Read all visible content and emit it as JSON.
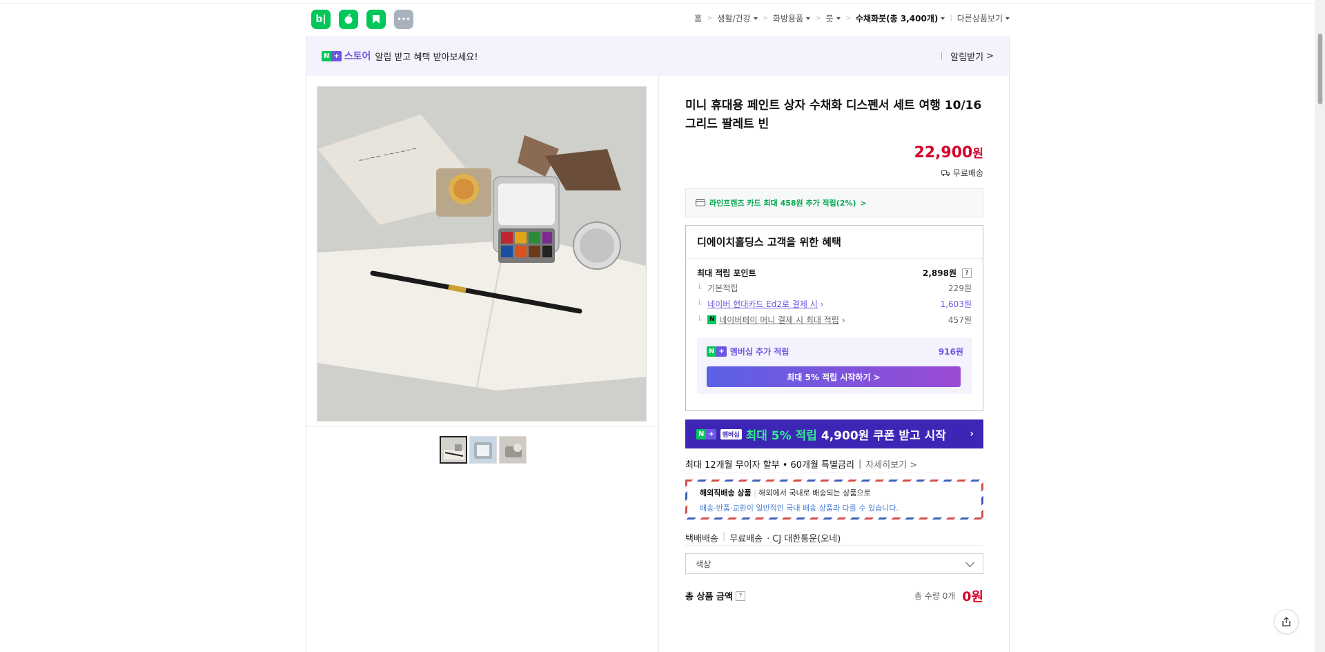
{
  "top_apps": [
    {
      "name": "blog-app-icon",
      "label": "b|",
      "color": "#03c75a"
    },
    {
      "name": "cafe-app-icon",
      "label": "☕",
      "color": "#03c75a"
    },
    {
      "name": "bookmark-app-icon",
      "label": "",
      "color": "#03c75a"
    },
    {
      "name": "more-app-icon",
      "label": "•••",
      "color": "#a9b1bd"
    }
  ],
  "breadcrumb": {
    "home": "홈",
    "cat1": "생활/건강",
    "cat2": "화방용품",
    "cat3": "붓",
    "current": "수채화붓(총 3,400개)",
    "other": "다른상품보기"
  },
  "banner": {
    "n_badge": "N",
    "plus_badge": "+",
    "store": "스토어",
    "message": "알림 받고 혜택 받아보세요!",
    "alarm_button": "알림받기"
  },
  "product": {
    "title": "미니 휴대용 페인트 상자 수채화 디스펜서 세트 여행 10/16 그리드 팔레트 빈",
    "price": "22,900",
    "price_unit": "원",
    "shipping": "무료배송"
  },
  "card_benefit": "라인프렌즈 카드 최대 458원 추가 적립(2%)",
  "benefit_box": {
    "heading": "디에이치홀딩스 고객을 위한 혜택",
    "max_points_label": "최대 적립 포인트",
    "max_points_value": "2,898원",
    "qm": "?",
    "basic_label": "기본적립",
    "basic_value": "229원",
    "card_label": "네이버 현대카드 Ed2로 결제 시",
    "card_value": "1,603원",
    "pay_label": "네이버페이 머니 결제 시 최대 적립",
    "pay_value": "457원",
    "member_label": "멤버십 추가 적립",
    "member_value": "916원",
    "member_button": "최대 5% 적립 시작하기 >"
  },
  "promo": {
    "badge_n": "N",
    "badge_plus": "+",
    "badge_text": "멤버십",
    "highlight": "최대 5% 적립",
    "rest": "4,900원 쿠폰 받고 시작",
    "arrow": "›"
  },
  "installment": {
    "text": "최대 12개월 무이자 할부 • 60개월 특별금리",
    "detail": "자세히보기 >"
  },
  "overseas": {
    "title": "해외직배송 상품",
    "desc": "해외에서 국내로 배송되는 상품으로",
    "notice": "배송·반품·교환이 일반적인 국내 배송 상품과 다를 수 있습니다."
  },
  "delivery": {
    "type": "택배배송",
    "fee": "무료배송",
    "carrier": "· CJ 대한통운(오네)"
  },
  "option_select": {
    "placeholder": "색상"
  },
  "total": {
    "label": "총 상품 금액",
    "qm": "?",
    "qty": "총 수량 0개",
    "amount": "0원"
  },
  "colors": {
    "naver_green": "#03c75a",
    "price_red": "#d9002b",
    "membership_purple": "#6b57e0",
    "promo_navy": "#3d25b5"
  }
}
